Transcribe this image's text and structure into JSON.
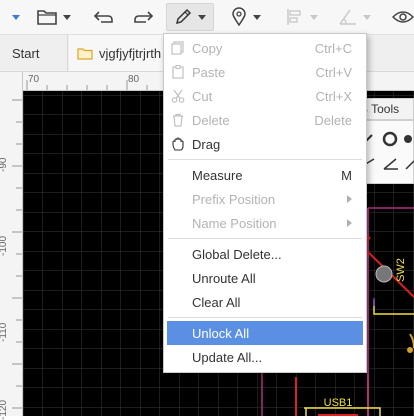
{
  "toolbar": {
    "icons": [
      "arrow-down-icon",
      "folder-icon",
      "undo-icon",
      "redo-icon",
      "pencil-icon",
      "map-pin-icon",
      "align-icon",
      "measure-angle-icon",
      "eye-icon"
    ]
  },
  "tabs": [
    {
      "label": "Start"
    },
    {
      "label": "vjgfjyfjtrjrth"
    }
  ],
  "ruler": {
    "top": [
      "70",
      "80"
    ],
    "left": [
      "-90",
      "-100",
      "-110",
      "-120"
    ]
  },
  "canvas": {
    "labels": {
      "sw2": "SW2",
      "usb1": "USB1"
    },
    "colors": {
      "background": "#000000",
      "grid": "#3a3a3a",
      "outline": "#b0307a",
      "silkscreen": "#f0e040",
      "track": "#e02020"
    }
  },
  "pcb_tools": {
    "label": "B Tools"
  },
  "menu": {
    "items": [
      {
        "label": "Copy",
        "shortcut": "Ctrl+C",
        "enabled": false,
        "icon": "copy-icon"
      },
      {
        "label": "Paste",
        "shortcut": "Ctrl+V",
        "enabled": false,
        "icon": "paste-icon"
      },
      {
        "label": "Cut",
        "shortcut": "Ctrl+X",
        "enabled": false,
        "icon": "scissors-icon"
      },
      {
        "label": "Delete",
        "shortcut": "Delete",
        "enabled": false,
        "icon": "trash-icon"
      },
      {
        "label": "Drag",
        "shortcut": "",
        "enabled": true,
        "icon": "hand-icon"
      },
      {
        "label": "Measure",
        "shortcut": "M",
        "enabled": true
      },
      {
        "label": "Prefix Position",
        "enabled": false,
        "submenu": true
      },
      {
        "label": "Name Position",
        "enabled": false,
        "submenu": true
      },
      {
        "label": "Global Delete...",
        "enabled": true
      },
      {
        "label": "Unroute All",
        "enabled": true
      },
      {
        "label": "Clear All",
        "enabled": true
      },
      {
        "label": "Unlock All",
        "enabled": true,
        "highlighted": true
      },
      {
        "label": "Update All...",
        "enabled": true
      }
    ],
    "highlight_color": "#5a8fe3"
  }
}
